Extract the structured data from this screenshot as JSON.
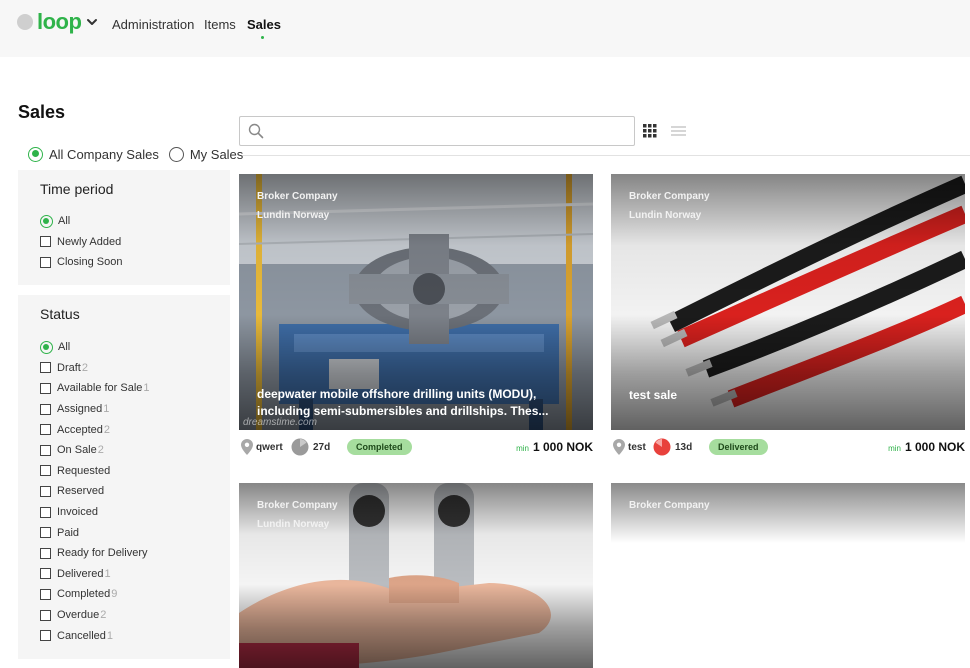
{
  "nav": {
    "logo_text": "loop",
    "links": [
      {
        "label": "Administration"
      },
      {
        "label": "Items"
      },
      {
        "label": "Sales"
      }
    ],
    "active": "Sales",
    "accent_color": "#2fb34a"
  },
  "page": {
    "title": "Sales",
    "scope_options": [
      {
        "label": "All Company Sales",
        "selected": true
      },
      {
        "label": "My Sales",
        "selected": false
      }
    ]
  },
  "search": {
    "placeholder": "",
    "value": ""
  },
  "view_toggle": {
    "grid_icon": "grid-icon",
    "list_icon": "list-icon",
    "active": "grid"
  },
  "filters": {
    "time_period": {
      "title": "Time period",
      "options": [
        {
          "label": "All",
          "type": "radio",
          "selected": true
        },
        {
          "label": "Newly Added",
          "type": "checkbox"
        },
        {
          "label": "Closing Soon",
          "type": "checkbox"
        }
      ]
    },
    "status": {
      "title": "Status",
      "options": [
        {
          "label": "All",
          "type": "radio",
          "selected": true,
          "count": ""
        },
        {
          "label": "Draft",
          "type": "checkbox",
          "count": "2"
        },
        {
          "label": "Available for Sale",
          "type": "checkbox",
          "count": "1"
        },
        {
          "label": "Assigned",
          "type": "checkbox",
          "count": "1"
        },
        {
          "label": "Accepted",
          "type": "checkbox",
          "count": "2"
        },
        {
          "label": "On Sale",
          "type": "checkbox",
          "count": "2"
        },
        {
          "label": "Requested",
          "type": "checkbox",
          "count": ""
        },
        {
          "label": "Reserved",
          "type": "checkbox",
          "count": ""
        },
        {
          "label": "Invoiced",
          "type": "checkbox",
          "count": ""
        },
        {
          "label": "Paid",
          "type": "checkbox",
          "count": ""
        },
        {
          "label": "Ready for Delivery",
          "type": "checkbox",
          "count": ""
        },
        {
          "label": "Delivered",
          "type": "checkbox",
          "count": "1"
        },
        {
          "label": "Completed",
          "type": "checkbox",
          "count": "9"
        },
        {
          "label": "Overdue",
          "type": "checkbox",
          "count": "2"
        },
        {
          "label": "Cancelled",
          "type": "checkbox",
          "count": "1"
        }
      ]
    }
  },
  "cards": [
    {
      "broker": "Broker Company",
      "buyer": "Lundin Norway",
      "title": "deepwater mobile offshore drilling units (MODU), including semi-submersibles and drillships. Thes...",
      "watermark": "dreamstime.com",
      "location": "qwert",
      "days": "27d",
      "status": "Completed",
      "price_prefix": "min",
      "price": "1 000 NOK",
      "image": "turbine",
      "clock_color": "#9a9a9a"
    },
    {
      "broker": "Broker Company",
      "buyer": "Lundin Norway",
      "title": "test sale",
      "watermark": "",
      "location": "test",
      "days": "13d",
      "status": "Delivered",
      "price_prefix": "min",
      "price": "1 000 NOK",
      "image": "cables",
      "clock_color": "#e8413c"
    },
    {
      "broker": "Broker Company",
      "buyer": "Lundin Norway",
      "image": "wrench"
    },
    {
      "broker": "Broker Company",
      "image": "blank"
    }
  ]
}
